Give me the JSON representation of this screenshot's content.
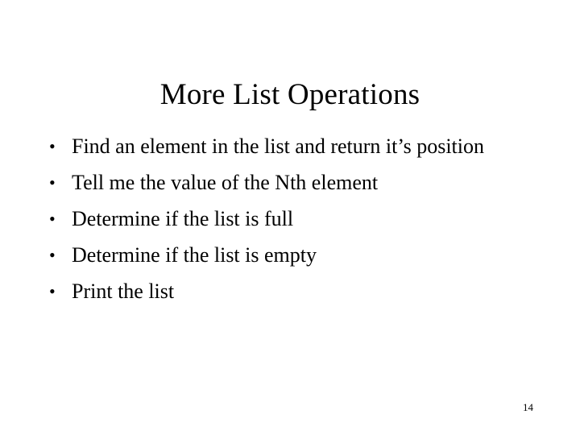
{
  "slide": {
    "title": "More List Operations",
    "bullet_marker": "•",
    "bullets": [
      {
        "text": "Find an element in the list and return it’s position"
      },
      {
        "text": "Tell me the value of the Nth element"
      },
      {
        "text": "Determine if the list is full"
      },
      {
        "text": "Determine if the list is empty"
      },
      {
        "text": "Print the list"
      }
    ],
    "slide_number": "14",
    "colors": {
      "background": "#ffffff",
      "text": "#000000"
    }
  }
}
